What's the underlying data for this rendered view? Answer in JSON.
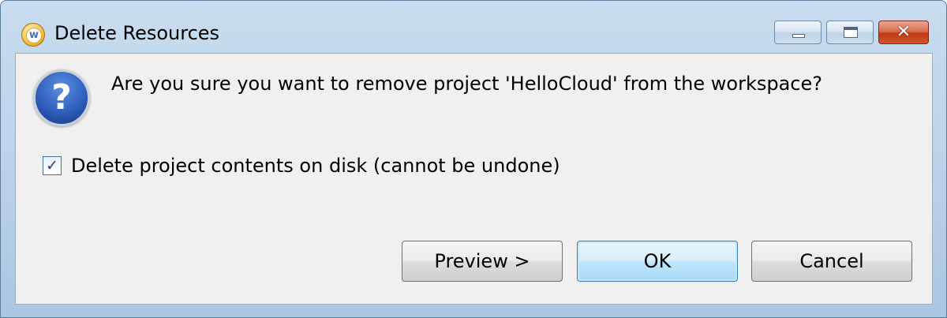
{
  "window": {
    "title": "Delete Resources",
    "app_icon_letter": "w",
    "controls": {
      "minimize_icon": "minimize-icon",
      "maximize_icon": "maximize-icon",
      "close_icon": "close-icon",
      "close_glyph": "✕"
    }
  },
  "dialog": {
    "icon": "question-icon",
    "icon_glyph": "?",
    "message": "Are you sure you want to remove project 'HelloCloud' from the workspace?",
    "checkbox": {
      "label": "Delete project contents on disk (cannot be undone)",
      "checked": true,
      "glyph": "✓"
    }
  },
  "buttons": {
    "preview_label": "Preview >",
    "ok_label": "OK",
    "cancel_label": "Cancel"
  },
  "colors": {
    "frame": "#bcd3ea",
    "client_background": "#f0f0f0",
    "close_button": "#c23a18",
    "default_button_accent": "#3c7fb1"
  }
}
